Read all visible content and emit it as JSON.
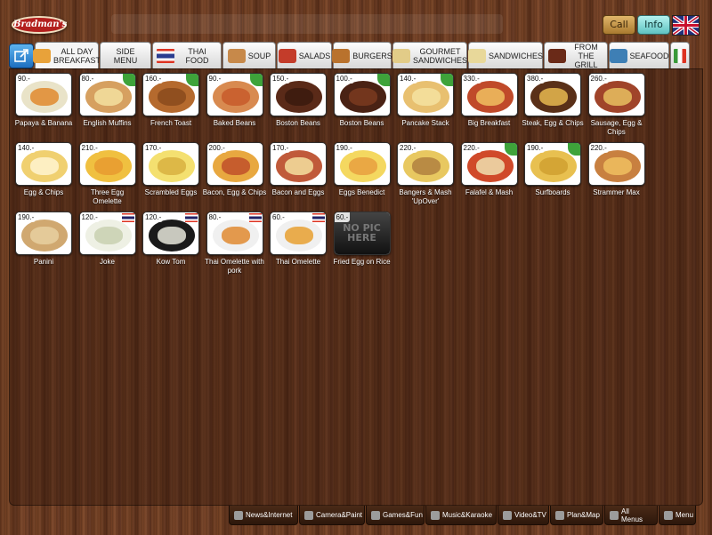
{
  "header": {
    "logo_text": "Bradman's",
    "call_label": "Call",
    "info_label": "Info",
    "language_flag": "uk-flag"
  },
  "tabs": [
    {
      "label": "ALL DAY BREAKFAST",
      "icon": "breakfast-icon",
      "icon_color": "#e8a23a",
      "width": 72
    },
    {
      "label": "SIDE MENU",
      "icon": "",
      "icon_color": "",
      "width": 58
    },
    {
      "label": "THAI FOOD",
      "icon": "thai-flag-icon",
      "icon_color": "#2a3c8f",
      "width": 78
    },
    {
      "label": "SOUP",
      "icon": "soup-icon",
      "icon_color": "#c7894a",
      "width": 60
    },
    {
      "label": "SALADS",
      "icon": "salad-icon",
      "icon_color": "#c43c2a",
      "width": 62
    },
    {
      "label": "BURGERS",
      "icon": "burger-icon",
      "icon_color": "#b9722d",
      "width": 66
    },
    {
      "label": "GOURMET SANDWICHES",
      "icon": "sandwich-icon",
      "icon_color": "#e2cc88",
      "width": 84
    },
    {
      "label": "SANDWICHES",
      "icon": "sandwich-icon",
      "icon_color": "#e8d89a",
      "width": 84
    },
    {
      "label": "FROM THE GRILL",
      "icon": "grill-icon",
      "icon_color": "#6a2a18",
      "width": 72
    },
    {
      "label": "SEAFOOD",
      "icon": "seafood-icon",
      "icon_color": "#3e7fb5",
      "width": 68
    },
    {
      "label": "",
      "icon": "italy-flag-icon",
      "icon_color": "#3a9a3a",
      "width": 22
    }
  ],
  "items": [
    {
      "name": "Papaya & Banana",
      "price": "90.-",
      "badge": "none",
      "c1": "#e9e3c8",
      "c2": "#e08a2e"
    },
    {
      "name": "English Muffins",
      "price": "80.-",
      "badge": "green",
      "c1": "#d6a060",
      "c2": "#f3e0a0"
    },
    {
      "name": "French Toast",
      "price": "160.-",
      "badge": "green",
      "c1": "#b56a2e",
      "c2": "#8a4a1c"
    },
    {
      "name": "Baked Beans",
      "price": "90.-",
      "badge": "green",
      "c1": "#d88a50",
      "c2": "#c85a2a"
    },
    {
      "name": "Boston Beans",
      "price": "150.-",
      "badge": "none",
      "c1": "#5a2a18",
      "c2": "#3b1a0e"
    },
    {
      "name": "Boston Beans",
      "price": "100.-",
      "badge": "green",
      "c1": "#4a2214",
      "c2": "#7a3a1e"
    },
    {
      "name": "Pancake Stack",
      "price": "140.-",
      "badge": "green",
      "c1": "#e8c070",
      "c2": "#f5e2a0"
    },
    {
      "name": "Big Breakfast",
      "price": "330.-",
      "badge": "none",
      "c1": "#c04a2a",
      "c2": "#f0c060"
    },
    {
      "name": "Steak, Egg & Chips",
      "price": "380.-",
      "badge": "none",
      "c1": "#5a3018",
      "c2": "#e8b850"
    },
    {
      "name": "Sausage, Egg & Chips",
      "price": "260.-",
      "badge": "none",
      "c1": "#a0442a",
      "c2": "#e8c060"
    },
    {
      "name": "Egg & Chips",
      "price": "140.-",
      "badge": "none",
      "c1": "#f0d070",
      "c2": "#fff4d0"
    },
    {
      "name": "Three Egg Omelette",
      "price": "210.-",
      "badge": "none",
      "c1": "#f0c040",
      "c2": "#e89a30"
    },
    {
      "name": "Scrambled Eggs",
      "price": "170.-",
      "badge": "none",
      "c1": "#f4e070",
      "c2": "#d8b040"
    },
    {
      "name": "Bacon, Egg & Chips",
      "price": "200.-",
      "badge": "none",
      "c1": "#e8a840",
      "c2": "#c0502a"
    },
    {
      "name": "Bacon and Eggs",
      "price": "170.-",
      "badge": "none",
      "c1": "#c05a3a",
      "c2": "#f4e0a0"
    },
    {
      "name": "Eggs Benedict",
      "price": "190.-",
      "badge": "none",
      "c1": "#f4d860",
      "c2": "#e8a040"
    },
    {
      "name": "Bangers & Mash 'UpOver'",
      "price": "220.-",
      "badge": "none",
      "c1": "#e8c860",
      "c2": "#b08040"
    },
    {
      "name": "Falafel & Mash",
      "price": "220.-",
      "badge": "green",
      "c1": "#d04a2a",
      "c2": "#f0e0b0"
    },
    {
      "name": "Surfboards",
      "price": "190.-",
      "badge": "green",
      "c1": "#e8c050",
      "c2": "#d0a030"
    },
    {
      "name": "Strammer Max",
      "price": "220.-",
      "badge": "none",
      "c1": "#c88040",
      "c2": "#f0c060"
    },
    {
      "name": "Panini",
      "price": "190.-",
      "badge": "none",
      "c1": "#d0a870",
      "c2": "#e8d0a0"
    },
    {
      "name": "Joke",
      "price": "120.-",
      "badge": "thai",
      "c1": "#eef0e4",
      "c2": "#c8d0b0"
    },
    {
      "name": "Kow Tom",
      "price": "120.-",
      "badge": "thai",
      "c1": "#1a1a1a",
      "c2": "#e8e8dc"
    },
    {
      "name": "Thai Omelette with pork",
      "price": "80.-",
      "badge": "thai",
      "c1": "#f0f0f0",
      "c2": "#e08a30"
    },
    {
      "name": "Thai Omelette",
      "price": "60.-",
      "badge": "thai",
      "c1": "#f0f0f0",
      "c2": "#e8a030"
    },
    {
      "name": "Fried Egg on Rice",
      "price": "60.-",
      "badge": "nopic",
      "c1": "#333333",
      "c2": "#222222"
    }
  ],
  "nopic_text": "NO PIC HERE",
  "bottom_bar": [
    {
      "label": "News&Internet",
      "icon": "news-icon",
      "width": 78
    },
    {
      "label": "Camera&Paint",
      "icon": "camera-icon",
      "width": 74
    },
    {
      "label": "Games&Fun",
      "icon": "gamepad-icon",
      "width": 66
    },
    {
      "label": "Music&Karaoke",
      "icon": "music-icon",
      "width": 80
    },
    {
      "label": "Video&TV",
      "icon": "eye-icon",
      "width": 58
    },
    {
      "label": "Plan&Map",
      "icon": "globe-icon",
      "width": 60
    },
    {
      "label": "All Menus",
      "icon": "cart-icon",
      "width": 60
    },
    {
      "label": "Menu",
      "icon": "menu-icon",
      "width": 42
    }
  ]
}
